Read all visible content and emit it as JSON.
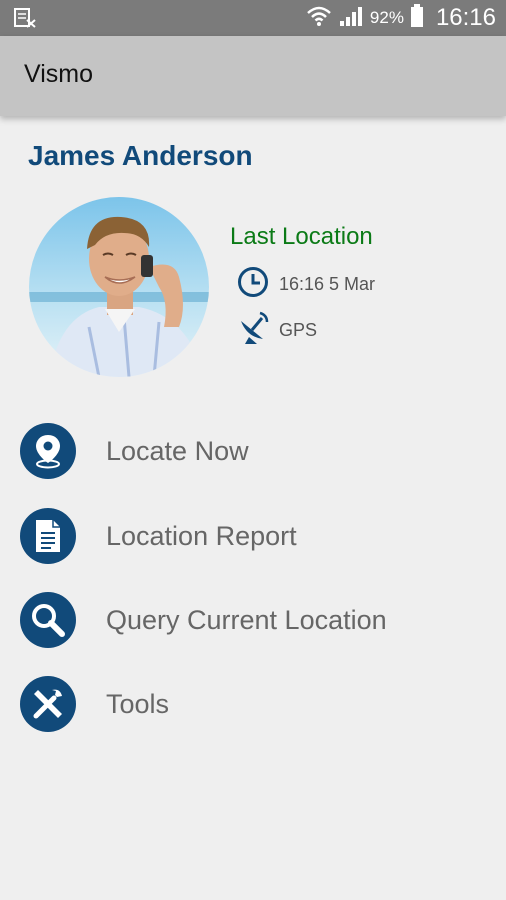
{
  "status_bar": {
    "notification_icon": "notification-icon",
    "wifi_icon": "wifi-icon",
    "signal_icon": "signal-icon",
    "battery_percent": "92%",
    "battery_icon": "battery-icon",
    "time": "16:16"
  },
  "app_bar": {
    "title": "Vismo"
  },
  "user": {
    "name": "James Anderson",
    "avatar": "user-photo"
  },
  "last_location": {
    "title": "Last Location",
    "time_icon": "clock-icon",
    "time": "16:16 5 Mar",
    "source_icon": "satellite-icon",
    "source": "GPS"
  },
  "menu": {
    "items": [
      {
        "label": "Locate Now",
        "icon": "location-pin-icon"
      },
      {
        "label": "Location Report",
        "icon": "document-icon"
      },
      {
        "label": "Query Current Location",
        "icon": "search-icon"
      },
      {
        "label": "Tools",
        "icon": "tools-icon"
      }
    ]
  },
  "colors": {
    "accent_blue": "#114a7a",
    "location_green": "#0b7a16",
    "status_bar": "#7b7b7b",
    "app_bar": "#c4c4c4",
    "background": "#efefef"
  }
}
